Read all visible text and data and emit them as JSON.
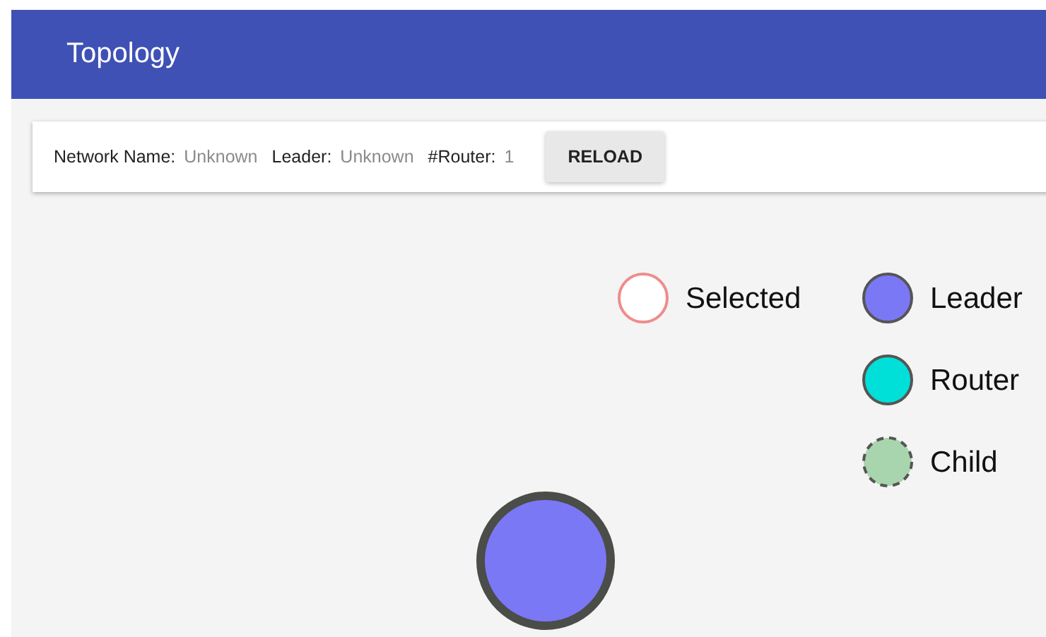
{
  "app_bar": {
    "title": "Topology"
  },
  "toolbar": {
    "fields": [
      {
        "label": "Network Name:",
        "value": "Unknown"
      },
      {
        "label": "Leader:",
        "value": "Unknown"
      },
      {
        "label": "#Router:",
        "value": "1"
      }
    ],
    "button": "RELOAD"
  },
  "legend": [
    {
      "kind": "selected",
      "label": "Selected",
      "color": "#ffffff"
    },
    {
      "kind": "leader",
      "label": "Leader",
      "color": "#7b78f5"
    },
    {
      "kind": "router",
      "label": "Router",
      "color": "#00dfd8"
    },
    {
      "kind": "child",
      "label": "Child",
      "color": "#a8d5ad"
    }
  ],
  "nodes": [
    {
      "kind": "leader"
    }
  ]
}
